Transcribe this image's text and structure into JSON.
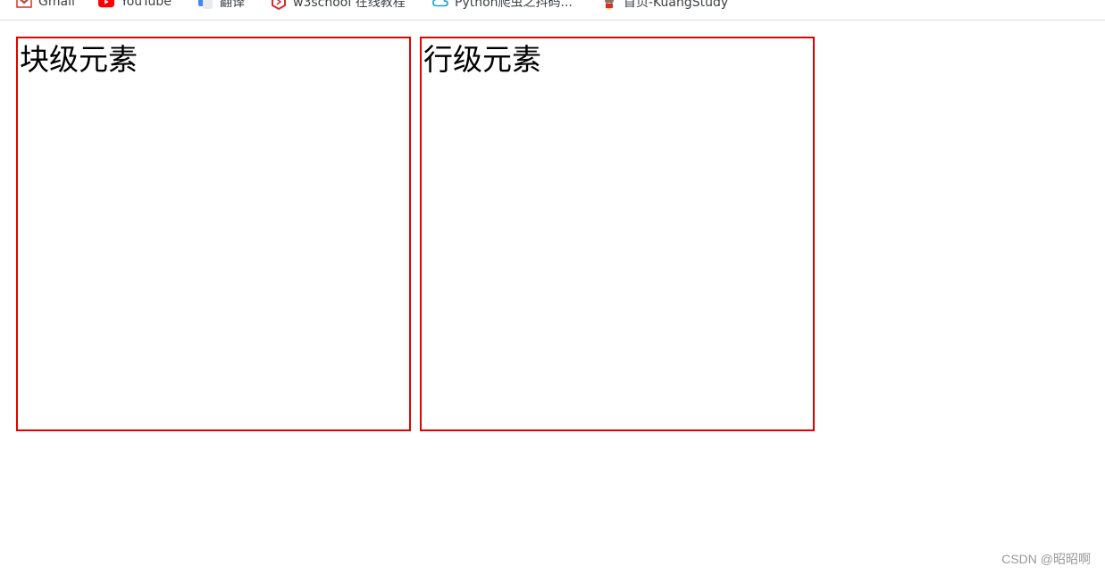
{
  "bookmarks": [
    {
      "label": "Gmail",
      "icon": "gmail-icon"
    },
    {
      "label": "YouTube",
      "icon": "youtube-icon"
    },
    {
      "label": "翻译",
      "icon": "translate-icon"
    },
    {
      "label": "w3school 在线教程",
      "icon": "w3school-icon"
    },
    {
      "label": "Python爬虫之抖码...",
      "icon": "cloud-link-icon"
    },
    {
      "label": "首页-KuangStudy",
      "icon": "kuangstudy-icon"
    }
  ],
  "content": {
    "block_label": "块级元素",
    "inline_label": "行级元素",
    "border_color": "#e60000"
  },
  "watermark": "CSDN @昭昭啊"
}
